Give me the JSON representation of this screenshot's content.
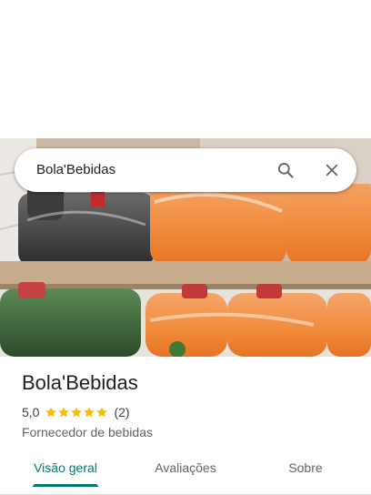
{
  "search": {
    "query": "Bola'Bebidas",
    "search_icon": "search-icon",
    "close_icon": "close-icon"
  },
  "place": {
    "name": "Bola'Bebidas",
    "rating": "5,0",
    "stars": 5,
    "review_count": "(2)",
    "category": "Fornecedor de bebidas"
  },
  "tabs": [
    {
      "label": "Visão geral",
      "active": true
    },
    {
      "label": "Avaliações",
      "active": false
    },
    {
      "label": "Sobre",
      "active": false
    }
  ],
  "colors": {
    "accent": "#00796b",
    "star": "#fbbc04",
    "text_primary": "#202124",
    "text_secondary": "#5f6368"
  }
}
